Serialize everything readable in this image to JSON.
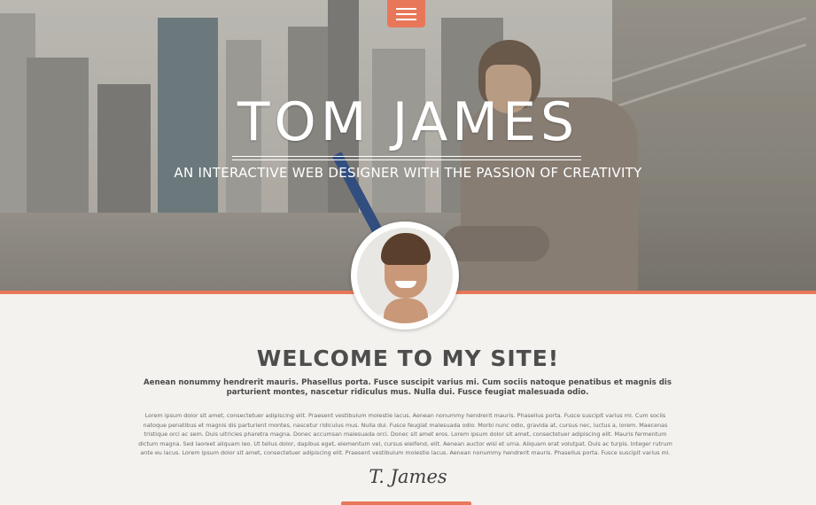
{
  "nav": {
    "menu_icon": "hamburger-icon"
  },
  "hero": {
    "title": "TOM JAMES",
    "subtitle": "AN INTERACTIVE WEB DESIGNER WITH THE PASSION OF CREATIVITY"
  },
  "content": {
    "heading": "WELCOME TO MY SITE!",
    "lead": "Aenean nonummy hendrerit mauris. Phasellus porta. Fusce suscipit varius mi. Cum sociis natoque penatibus et magnis dis parturient montes, nascetur ridiculus mus. Nulla dui. Fusce feugiat malesuada odio.",
    "body": "Lorem ipsum dolor sit amet, consectetuer adipiscing elit. Praesent vestibulum molestie lacus. Aenean nonummy hendrerit mauris. Phasellus porta. Fusce suscipit varius mi. Cum sociis natoque penatibus et magnis dis parturient montes, nascetur ridiculus mus. Nulla dui. Fusce feugiat malesuada odio. Morbi nunc odio, gravida at, cursus nec, luctus a, lorem. Maecenas tristique orci ac sem. Duis ultricies pharetra magna. Donec accumsan malesuada orci. Donec sit amet eros. Lorem ipsum dolor sit amet, consectetuer adipiscing elit. Mauris fermentum dictum magna. Sed laoreet aliquam leo. Ut tellus dolor, dapibus eget, elementum vel, cursus eleifend, elit. Aenean auctor wisi et urna. Aliquam erat volutpat. Duis ac turpis. Integer rutrum ante eu lacus. Lorem ipsum dolor sit amet, consectetuer adipiscing elit. Praesent vestibulum molestie lacus. Aenean nonummy hendrerit mauris. Phasellus porta. Fusce suscipit varius mi.",
    "signature": "T. James"
  },
  "colors": {
    "accent": "#e8775a",
    "heading": "#4d4d4d",
    "background": "#f4f2ef"
  }
}
